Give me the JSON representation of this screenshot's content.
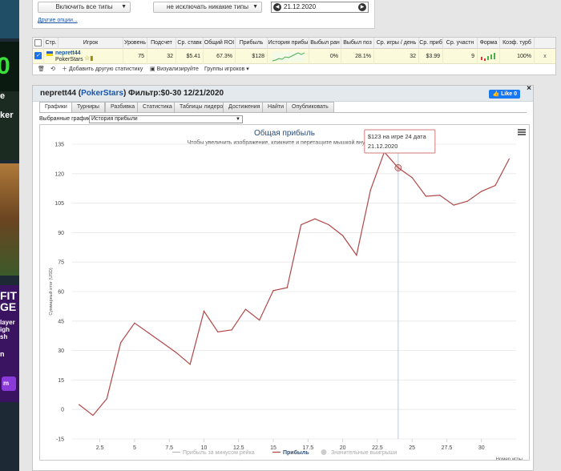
{
  "filters": {
    "include_all": "Включить все типы",
    "exclude_none": "не исключать никакие типы",
    "date": "21.12.2020",
    "other_options": "Другие опции..."
  },
  "stats_table": {
    "headers": [
      "Стр.",
      "Игрок",
      "Уровень",
      "Подсчет",
      "Ср. ставк",
      "Общий ROI",
      "Прибыль",
      "История прибы",
      "Выбыл ран",
      "Выбыл поз",
      "Ср. игры / день",
      "Ср. приб",
      "Ср. участн",
      "Форма",
      "Коэф. турб"
    ],
    "player": {
      "name": "neprett44",
      "site": "PokerStars"
    },
    "values": [
      "75",
      "32",
      "$5.41",
      "67.3%",
      "$128",
      "0%",
      "28.1%",
      "32",
      "$3.99",
      "9",
      "100%"
    ],
    "footer": {
      "add_stat": "Добавить другую статистику",
      "visualize": "Визуализируйте",
      "groups": "Группы игроков"
    }
  },
  "panel": {
    "title_player": "neprett44 (",
    "title_site": "PokerStars",
    "title_rest": ") Фильтр:$0-30 12/21/2020",
    "like": "Like 0",
    "close": "×",
    "tabs": [
      "Графики",
      "Турниры",
      "Разбивка",
      "Статистика",
      "Таблицы лидеров",
      "Достижения",
      "Найти",
      "Опубликовать"
    ],
    "active_tab": 0,
    "chart_select_label": "Выбранные графики:",
    "chart_select_value": "История прибыли"
  },
  "colors": {
    "profit_line": "#b04848",
    "grid": "#e6e6e6",
    "link": "#1a55a8"
  },
  "chart_data": {
    "type": "line",
    "title": "Общая прибыль",
    "subtitle": "Чтобы увеличить изображение, кликните и перетащите мышкой внутри",
    "xlabel": "Номер игры",
    "ylabel": "Суммарный итог (USD)",
    "ylim": [
      -15,
      135
    ],
    "yticks": [
      -15,
      0,
      15,
      30,
      45,
      60,
      75,
      90,
      105,
      120,
      135
    ],
    "xlim": [
      0.5,
      32.5
    ],
    "xticks": [
      2.5,
      5,
      7.5,
      10,
      12.5,
      15,
      17.5,
      20,
      22.5,
      25,
      27.5,
      30
    ],
    "legend": [
      "Прибыль за минусом рейка",
      "Прибыль",
      "Значительные выигрыши"
    ],
    "legend_active": 1,
    "series": [
      {
        "name": "Прибыль",
        "x": [
          1,
          2,
          3,
          4,
          5,
          6,
          7,
          8,
          9,
          10,
          11,
          12,
          13,
          14,
          15,
          16,
          17,
          18,
          19,
          20,
          21,
          22,
          23,
          24,
          25,
          26,
          27,
          28,
          29,
          30,
          31,
          32
        ],
        "values": [
          2.5,
          -3,
          5.5,
          34,
          44,
          39,
          34,
          29,
          23,
          50,
          39.5,
          40.5,
          51,
          45.5,
          60.5,
          62,
          94,
          97,
          94,
          88.5,
          78.5,
          111.5,
          131,
          123,
          118,
          108.5,
          109,
          104,
          106,
          111,
          114,
          127.5
        ]
      }
    ],
    "tooltip": {
      "line1": "$123 на игре 24 дата",
      "line2": "21.12.2020"
    }
  }
}
